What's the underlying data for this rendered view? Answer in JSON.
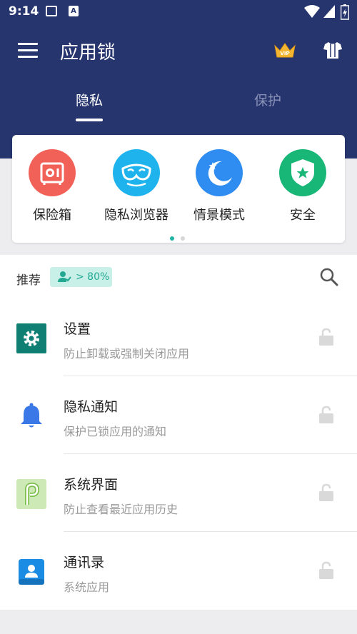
{
  "status_bar": {
    "time": "9:14",
    "a_badge": "A"
  },
  "header": {
    "title": "应用锁",
    "crown_icon": "crown-vip-icon",
    "crown_text": "VIP",
    "skin_icon": "tshirt-icon",
    "tabs": [
      {
        "label": "隐私",
        "active": true
      },
      {
        "label": "保护",
        "active": false
      }
    ]
  },
  "features": [
    {
      "label": "保险箱",
      "icon": "vault-icon",
      "color": "#f26158"
    },
    {
      "label": "隐私浏览器",
      "icon": "mask-icon",
      "color": "#1fb3ed"
    },
    {
      "label": "情景模式",
      "icon": "moon-icon",
      "color": "#2f8cf0"
    },
    {
      "label": "安全",
      "icon": "shield-icon",
      "color": "#18b777"
    }
  ],
  "recommend": {
    "label": "推荐",
    "badge": "> 80%",
    "badge_color": "#23a992"
  },
  "apps": [
    {
      "name": "设置",
      "desc": "防止卸载或强制关闭应用",
      "icon": "settings-gear-icon"
    },
    {
      "name": "隐私通知",
      "desc": "保护已锁应用的通知",
      "icon": "bell-icon"
    },
    {
      "name": "系统界面",
      "desc": "防止查看最近应用历史",
      "icon": "system-ui-icon"
    },
    {
      "name": "通讯录",
      "desc": "系统应用",
      "icon": "contacts-icon"
    }
  ]
}
